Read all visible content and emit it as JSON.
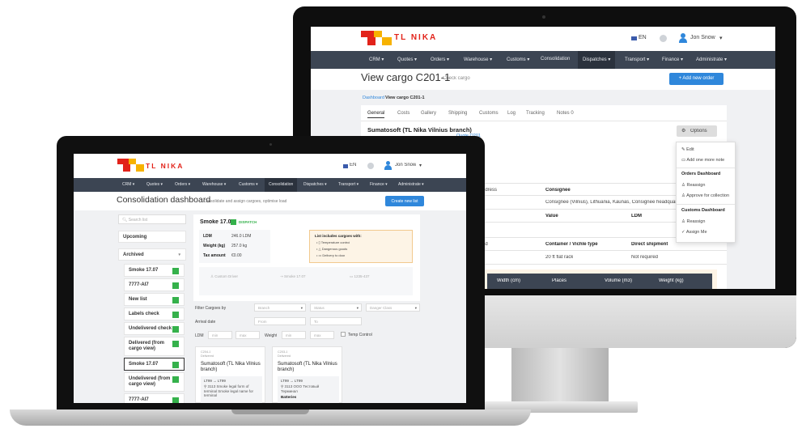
{
  "colors": {
    "nav_bg": "#3c4553",
    "accent_blue": "#2f87db",
    "logo_red": "#e2231a",
    "logo_yellow": "#f7b200",
    "dispatch_green": "#35b14b",
    "options_bg": "#dddddd",
    "note_bg": "#fdf4e6"
  },
  "monitor": {
    "brand": "TL NIKA",
    "lang": "EN",
    "user": "Jon Snow",
    "nav": [
      "CRM ▾",
      "Quotes ▾",
      "Orders ▾",
      "Warehouse ▾",
      "Customs ▾",
      "Consolidation",
      "Dispatches ▾",
      "Transport ▾",
      "Finance ▾",
      "Administrate ▾"
    ],
    "page_title": "View cargo C201-1",
    "page_subtitle": "Check cargo",
    "add_button": "Add new order",
    "breadcrumb_home": "Dashboard",
    "breadcrumb_current": "View cargo C201-1",
    "tabs": [
      "General",
      "Costs",
      "Gallery",
      "Shipping",
      "Customs",
      "Log",
      "Tracking",
      "Notes 0"
    ],
    "cargo_title": "Sumatosoft (TL Nika Vilnius branch)",
    "quote_link": "Quote Q201",
    "options_button": "Options",
    "options_menu": {
      "items": [
        "Edit",
        "Add one more note"
      ],
      "orders_head": "Orders Dashboard",
      "orders_items": [
        "Reassign",
        "Approve for collection"
      ],
      "customs_head": "Customs Dashboard",
      "customs_items": [
        "Reassign",
        "Assign Me"
      ]
    },
    "table1": {
      "address_fragment": "ddress",
      "consignee_head": "Consignee",
      "consignee_value": "Consignee (Vilnius), Lithuania, Kaunas, Consignee headquarte"
    },
    "table2": {
      "value_head": "Value",
      "ldm_head": "LDM"
    },
    "table3": {
      "ad_fragment": "ad",
      "container_head": "Container / Vichle type",
      "direct_head": "Direct shipment",
      "container_value": "20 ft flat rack",
      "direct_value": "Not required"
    },
    "dims_header": [
      "Width (cm)",
      "Places",
      "Volume (m3)",
      "Weight (kg)"
    ]
  },
  "laptop": {
    "brand": "TL NIKA",
    "lang": "EN",
    "user": "Jon Snow",
    "nav": [
      "CRM ▾",
      "Quotes ▾",
      "Orders ▾",
      "Warehouse ▾",
      "Customs ▾",
      "Consolidation",
      "Dispatches ▾",
      "Transport ▾",
      "Finance ▾",
      "Administrate ▾"
    ],
    "page_title": "Consolidation dashboard",
    "page_subtitle": "Consolidate and assign cargoes, optimise load",
    "create_button": "Create new list",
    "search_placeholder": "Search list",
    "upcoming": "Upcoming",
    "archived": "Archived",
    "lists": [
      "Smoke 17.07",
      "7777-AI7",
      "New list",
      "Labels check",
      "Undelivered check",
      "Delivered (from cargo view)",
      "Smoke 17.07",
      "Undelivered (from cargo view)",
      "7777-AI7"
    ],
    "list_title": "Smoke 17.07",
    "dispatch": "DISPATCH",
    "stats": [
      {
        "label": "LDM",
        "value": "246.0 LDM"
      },
      {
        "label": "Weight (kg)",
        "value": "257.0 kg"
      },
      {
        "label": "Tax amount",
        "value": "€0.00"
      }
    ],
    "includes_title": "List includes cargoes with:",
    "includes_items": [
      "Temperature control",
      "Dangerous goods",
      "Delivery to door"
    ],
    "driver_placeholder": "Custom Driver",
    "route_value": "Smoke 17.07",
    "plate_value": "1235-437",
    "filter_label": "Filter Cargoes by",
    "filter_branch": "Branch",
    "filter_status": "Status",
    "filter_danger": "Danger Class",
    "arrival_label": "Arrival date",
    "from_placeholder": "From",
    "to_placeholder": "To",
    "ldm_label": "LDM",
    "min1": "min",
    "max1": "max",
    "weight_label": "Weight",
    "min2": "min",
    "max2": "max",
    "temp_label": "Temp Control",
    "cards": [
      {
        "code": "C204-1",
        "status": "Delivered",
        "title": "Sumatosoft (TL Nika Vilnius branch)",
        "route": "LT99 → LT99",
        "addr": "3113 Smoke legal form of terminal Smoke legal name for terminal"
      },
      {
        "code": "C203-1",
        "status": "Delivered",
        "title": "Sumatosoft (TL Nika Vilnius branch)",
        "route": "LT99 → LT99",
        "addr": "3113 ООО Тестовый Терминал",
        "extra": "Batteries"
      }
    ]
  }
}
